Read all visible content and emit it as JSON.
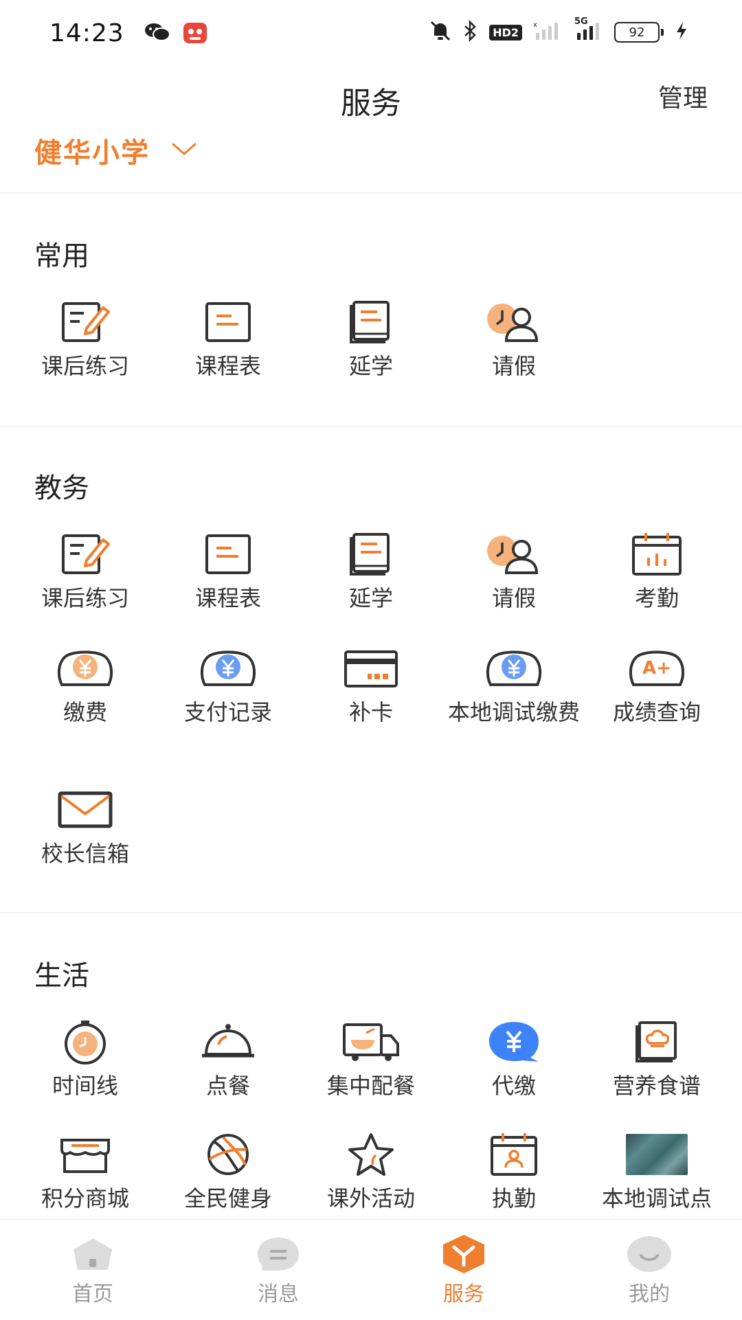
{
  "status_bar": {
    "time": "14:23",
    "battery": "92",
    "hd_badge": "HD2",
    "network": "5G",
    "icons": [
      "wechat-icon",
      "app-icon",
      "mute-icon",
      "bluetooth-icon",
      "signal-icon",
      "battery-icon",
      "charging-icon"
    ]
  },
  "header": {
    "title": "服务",
    "manage_label": "管理",
    "school_name": "健华小学"
  },
  "colors": {
    "accent": "#ef7e2e",
    "blue": "#3e82f7",
    "text": "#333333",
    "muted": "#999999"
  },
  "sections": {
    "common": {
      "title": "常用",
      "items": [
        {
          "label": "课后练习",
          "icon": "homework-icon"
        },
        {
          "label": "课程表",
          "icon": "schedule-icon"
        },
        {
          "label": "延学",
          "icon": "extended-study-icon"
        },
        {
          "label": "请假",
          "icon": "leave-icon"
        }
      ]
    },
    "academic": {
      "title": "教务",
      "items": [
        {
          "label": "课后练习",
          "icon": "homework-icon"
        },
        {
          "label": "课程表",
          "icon": "schedule-icon"
        },
        {
          "label": "延学",
          "icon": "extended-study-icon"
        },
        {
          "label": "请假",
          "icon": "leave-icon"
        },
        {
          "label": "考勤",
          "icon": "attendance-icon"
        },
        {
          "label": "缴费",
          "icon": "payment-icon"
        },
        {
          "label": "支付记录",
          "icon": "payment-record-icon"
        },
        {
          "label": "补卡",
          "icon": "card-reissue-icon"
        },
        {
          "label": "本地调试缴费",
          "icon": "local-debug-payment-icon"
        },
        {
          "label": "成绩查询",
          "icon": "grade-query-icon"
        },
        {
          "label": "校长信箱",
          "icon": "principal-mailbox-icon"
        }
      ]
    },
    "life": {
      "title": "生活",
      "items": [
        {
          "label": "时间线",
          "icon": "timeline-icon"
        },
        {
          "label": "点餐",
          "icon": "order-meal-icon"
        },
        {
          "label": "集中配餐",
          "icon": "meal-delivery-icon"
        },
        {
          "label": "代缴",
          "icon": "proxy-payment-icon"
        },
        {
          "label": "营养食谱",
          "icon": "nutrition-recipe-icon"
        },
        {
          "label": "积分商城",
          "icon": "points-mall-icon"
        },
        {
          "label": "全民健身",
          "icon": "fitness-icon"
        },
        {
          "label": "课外活动",
          "icon": "extracurricular-icon"
        },
        {
          "label": "执勤",
          "icon": "duty-icon"
        },
        {
          "label": "本地调试点",
          "icon": "local-debug-point-image"
        }
      ]
    }
  },
  "tab_bar": {
    "tabs": [
      {
        "label": "首页",
        "icon": "home-icon",
        "active": false
      },
      {
        "label": "消息",
        "icon": "message-icon",
        "active": false
      },
      {
        "label": "服务",
        "icon": "service-icon",
        "active": true
      },
      {
        "label": "我的",
        "icon": "profile-icon",
        "active": false
      }
    ]
  }
}
